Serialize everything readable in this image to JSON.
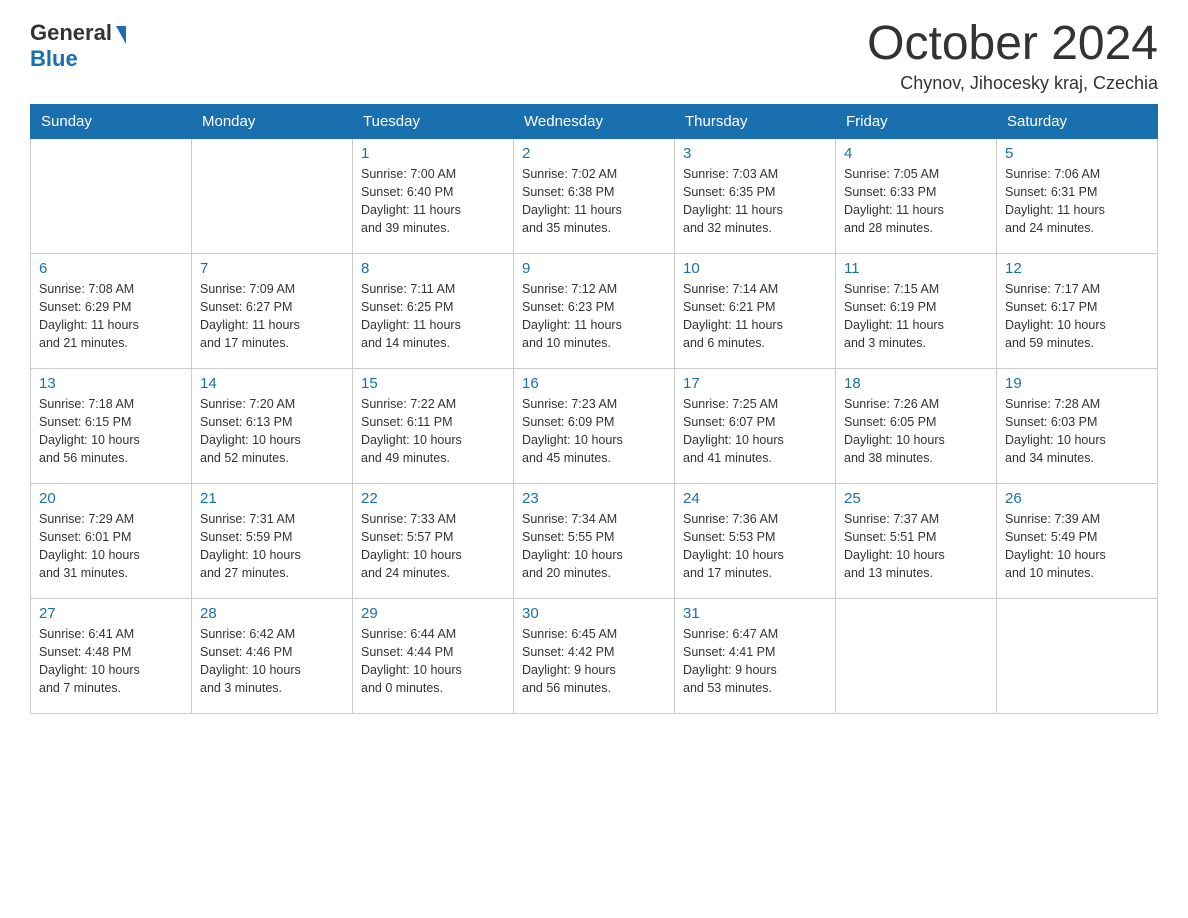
{
  "header": {
    "logo_general": "General",
    "logo_blue": "Blue",
    "month_title": "October 2024",
    "location": "Chynov, Jihocesky kraj, Czechia"
  },
  "days_of_week": [
    "Sunday",
    "Monday",
    "Tuesday",
    "Wednesday",
    "Thursday",
    "Friday",
    "Saturday"
  ],
  "weeks": [
    [
      {
        "day": "",
        "info": ""
      },
      {
        "day": "",
        "info": ""
      },
      {
        "day": "1",
        "info": "Sunrise: 7:00 AM\nSunset: 6:40 PM\nDaylight: 11 hours\nand 39 minutes."
      },
      {
        "day": "2",
        "info": "Sunrise: 7:02 AM\nSunset: 6:38 PM\nDaylight: 11 hours\nand 35 minutes."
      },
      {
        "day": "3",
        "info": "Sunrise: 7:03 AM\nSunset: 6:35 PM\nDaylight: 11 hours\nand 32 minutes."
      },
      {
        "day": "4",
        "info": "Sunrise: 7:05 AM\nSunset: 6:33 PM\nDaylight: 11 hours\nand 28 minutes."
      },
      {
        "day": "5",
        "info": "Sunrise: 7:06 AM\nSunset: 6:31 PM\nDaylight: 11 hours\nand 24 minutes."
      }
    ],
    [
      {
        "day": "6",
        "info": "Sunrise: 7:08 AM\nSunset: 6:29 PM\nDaylight: 11 hours\nand 21 minutes."
      },
      {
        "day": "7",
        "info": "Sunrise: 7:09 AM\nSunset: 6:27 PM\nDaylight: 11 hours\nand 17 minutes."
      },
      {
        "day": "8",
        "info": "Sunrise: 7:11 AM\nSunset: 6:25 PM\nDaylight: 11 hours\nand 14 minutes."
      },
      {
        "day": "9",
        "info": "Sunrise: 7:12 AM\nSunset: 6:23 PM\nDaylight: 11 hours\nand 10 minutes."
      },
      {
        "day": "10",
        "info": "Sunrise: 7:14 AM\nSunset: 6:21 PM\nDaylight: 11 hours\nand 6 minutes."
      },
      {
        "day": "11",
        "info": "Sunrise: 7:15 AM\nSunset: 6:19 PM\nDaylight: 11 hours\nand 3 minutes."
      },
      {
        "day": "12",
        "info": "Sunrise: 7:17 AM\nSunset: 6:17 PM\nDaylight: 10 hours\nand 59 minutes."
      }
    ],
    [
      {
        "day": "13",
        "info": "Sunrise: 7:18 AM\nSunset: 6:15 PM\nDaylight: 10 hours\nand 56 minutes."
      },
      {
        "day": "14",
        "info": "Sunrise: 7:20 AM\nSunset: 6:13 PM\nDaylight: 10 hours\nand 52 minutes."
      },
      {
        "day": "15",
        "info": "Sunrise: 7:22 AM\nSunset: 6:11 PM\nDaylight: 10 hours\nand 49 minutes."
      },
      {
        "day": "16",
        "info": "Sunrise: 7:23 AM\nSunset: 6:09 PM\nDaylight: 10 hours\nand 45 minutes."
      },
      {
        "day": "17",
        "info": "Sunrise: 7:25 AM\nSunset: 6:07 PM\nDaylight: 10 hours\nand 41 minutes."
      },
      {
        "day": "18",
        "info": "Sunrise: 7:26 AM\nSunset: 6:05 PM\nDaylight: 10 hours\nand 38 minutes."
      },
      {
        "day": "19",
        "info": "Sunrise: 7:28 AM\nSunset: 6:03 PM\nDaylight: 10 hours\nand 34 minutes."
      }
    ],
    [
      {
        "day": "20",
        "info": "Sunrise: 7:29 AM\nSunset: 6:01 PM\nDaylight: 10 hours\nand 31 minutes."
      },
      {
        "day": "21",
        "info": "Sunrise: 7:31 AM\nSunset: 5:59 PM\nDaylight: 10 hours\nand 27 minutes."
      },
      {
        "day": "22",
        "info": "Sunrise: 7:33 AM\nSunset: 5:57 PM\nDaylight: 10 hours\nand 24 minutes."
      },
      {
        "day": "23",
        "info": "Sunrise: 7:34 AM\nSunset: 5:55 PM\nDaylight: 10 hours\nand 20 minutes."
      },
      {
        "day": "24",
        "info": "Sunrise: 7:36 AM\nSunset: 5:53 PM\nDaylight: 10 hours\nand 17 minutes."
      },
      {
        "day": "25",
        "info": "Sunrise: 7:37 AM\nSunset: 5:51 PM\nDaylight: 10 hours\nand 13 minutes."
      },
      {
        "day": "26",
        "info": "Sunrise: 7:39 AM\nSunset: 5:49 PM\nDaylight: 10 hours\nand 10 minutes."
      }
    ],
    [
      {
        "day": "27",
        "info": "Sunrise: 6:41 AM\nSunset: 4:48 PM\nDaylight: 10 hours\nand 7 minutes."
      },
      {
        "day": "28",
        "info": "Sunrise: 6:42 AM\nSunset: 4:46 PM\nDaylight: 10 hours\nand 3 minutes."
      },
      {
        "day": "29",
        "info": "Sunrise: 6:44 AM\nSunset: 4:44 PM\nDaylight: 10 hours\nand 0 minutes."
      },
      {
        "day": "30",
        "info": "Sunrise: 6:45 AM\nSunset: 4:42 PM\nDaylight: 9 hours\nand 56 minutes."
      },
      {
        "day": "31",
        "info": "Sunrise: 6:47 AM\nSunset: 4:41 PM\nDaylight: 9 hours\nand 53 minutes."
      },
      {
        "day": "",
        "info": ""
      },
      {
        "day": "",
        "info": ""
      }
    ]
  ]
}
